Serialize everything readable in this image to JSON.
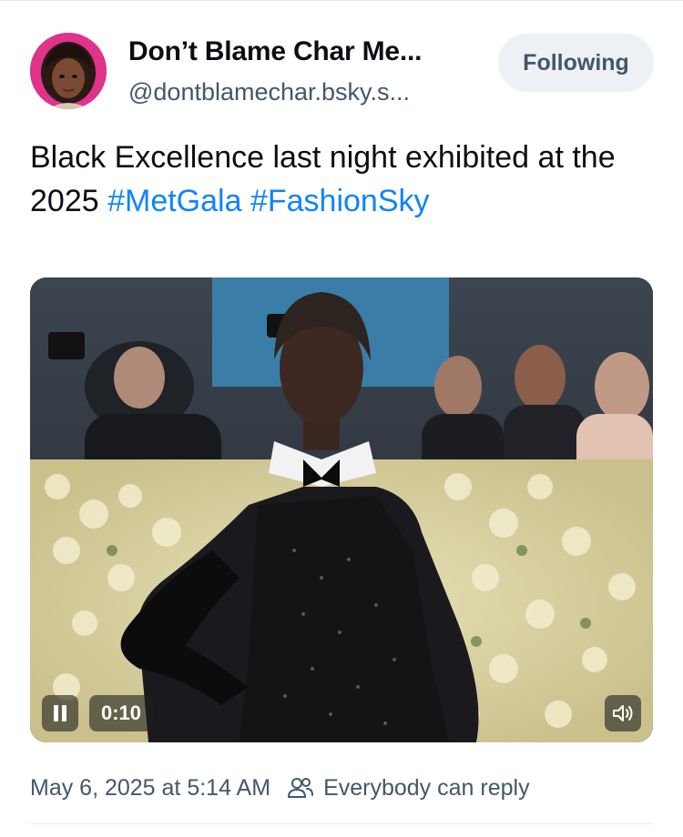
{
  "post": {
    "author": {
      "display_name": "Don’t Blame Char Me...",
      "handle": "@dontblamechar.bsky.s...",
      "avatar_icon": "avatar-photo"
    },
    "follow_label": "Following",
    "text_prefix": "Black Excellence last night exhibited at the 2025 ",
    "hashtags": [
      "#MetGala",
      "#FashionSky"
    ],
    "video": {
      "time": "0:10",
      "state": "playing",
      "controls": [
        "pause-icon",
        "volume-icon"
      ]
    },
    "timestamp": "May 6, 2025 at 5:14 AM",
    "reply_setting": "Everybody can reply",
    "reply_icon": "people-icon"
  },
  "colors": {
    "accent": "#1083fe",
    "muted_text": "#42576c",
    "button_bg": "#eef1f4",
    "avatar_ring": "#e0338a"
  }
}
